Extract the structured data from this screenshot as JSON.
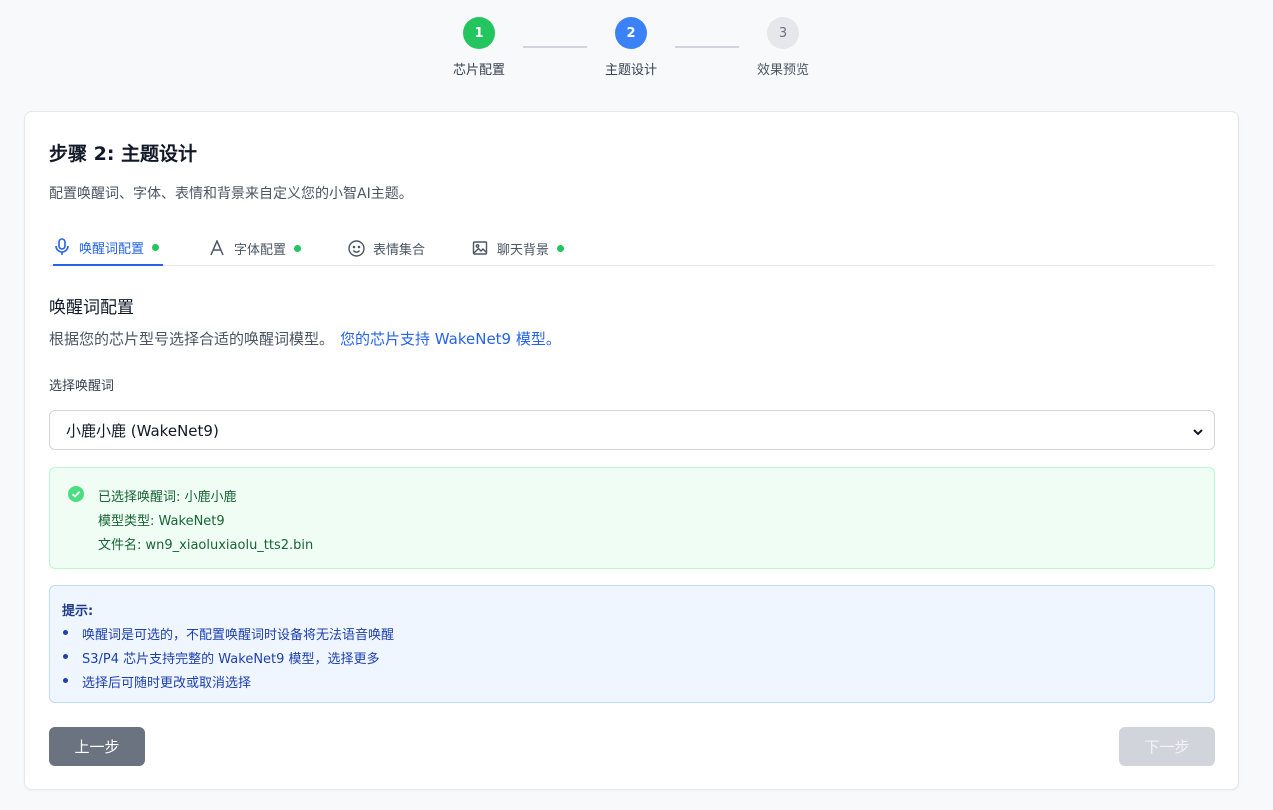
{
  "stepper": {
    "steps": [
      {
        "number": "1",
        "label": "芯片配置",
        "status": "completed",
        "color": "#22c55e"
      },
      {
        "number": "2",
        "label": "主题设计",
        "status": "active",
        "color": "#3b82f6"
      },
      {
        "number": "3",
        "label": "效果预览",
        "status": "pending",
        "color": "#e5e7eb"
      }
    ]
  },
  "card": {
    "title": "步骤 2: 主题设计",
    "description": "配置唤醒词、字体、表情和背景来自定义您的小智AI主题。"
  },
  "tabs": [
    {
      "label": "唤醒词配置",
      "icon": "microphone-icon",
      "active": true,
      "has_dot": true
    },
    {
      "label": "字体配置",
      "icon": "font-icon",
      "active": false,
      "has_dot": true
    },
    {
      "label": "表情集合",
      "icon": "smiley-icon",
      "active": false,
      "has_dot": false
    },
    {
      "label": "聊天背景",
      "icon": "image-icon",
      "active": false,
      "has_dot": true
    }
  ],
  "section": {
    "title": "唤醒词配置",
    "description": "根据您的芯片型号选择合适的唤醒词模型。",
    "highlight": "您的芯片支持 WakeNet9 模型。"
  },
  "field": {
    "label": "选择唤醒词",
    "selected_value": "小鹿小鹿 (WakeNet9)"
  },
  "success": {
    "line1": "已选择唤醒词: 小鹿小鹿",
    "line2": "模型类型: WakeNet9",
    "line3": "文件名: wn9_xiaoluxiaolu_tts2.bin"
  },
  "tip": {
    "title": "提示:",
    "items": [
      "唤醒词是可选的，不配置唤醒词时设备将无法语音唤醒",
      "S3/P4 芯片支持完整的 WakeNet9 模型，选择更多",
      "选择后可随时更改或取消选择"
    ]
  },
  "buttons": {
    "prev": "上一步",
    "next": "下一步"
  },
  "colors": {
    "accent": "#2563eb",
    "success": "#22c55e",
    "prev_button": "#6b7280",
    "next_button_disabled": "#d1d5db"
  }
}
